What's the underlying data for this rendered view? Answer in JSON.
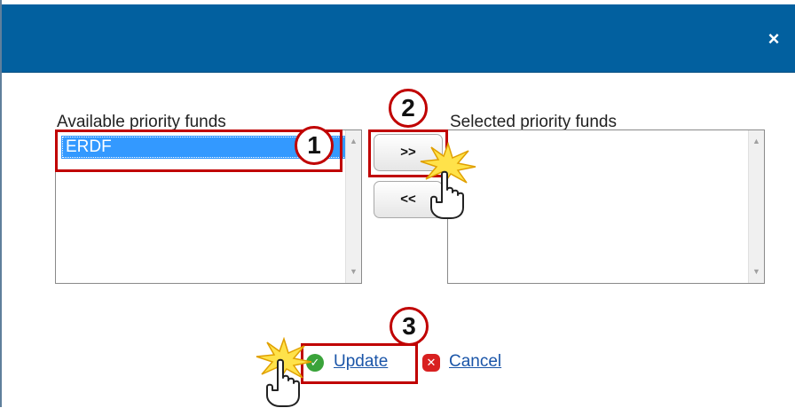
{
  "dialog": {
    "close_label": "×"
  },
  "available": {
    "label": "Available priority funds",
    "items": [
      "ERDF"
    ]
  },
  "selected": {
    "label": "Selected priority funds",
    "items": []
  },
  "buttons": {
    "add_label": ">>",
    "remove_label": "<<"
  },
  "actions": {
    "update_label": "Update",
    "cancel_label": "Cancel"
  },
  "steps": [
    "1",
    "2",
    "3"
  ],
  "icons": {
    "close": "close-icon",
    "update": "check-circle-icon",
    "cancel": "x-circle-icon",
    "pointer": "hand-pointer-icon",
    "click": "click-burst-icon"
  },
  "colors": {
    "titlebar": "#02609f",
    "selection": "#3399ff",
    "callout": "#c00000",
    "link": "#1a55a8",
    "update_icon": "#3aa33a",
    "cancel_icon": "#d82020"
  }
}
